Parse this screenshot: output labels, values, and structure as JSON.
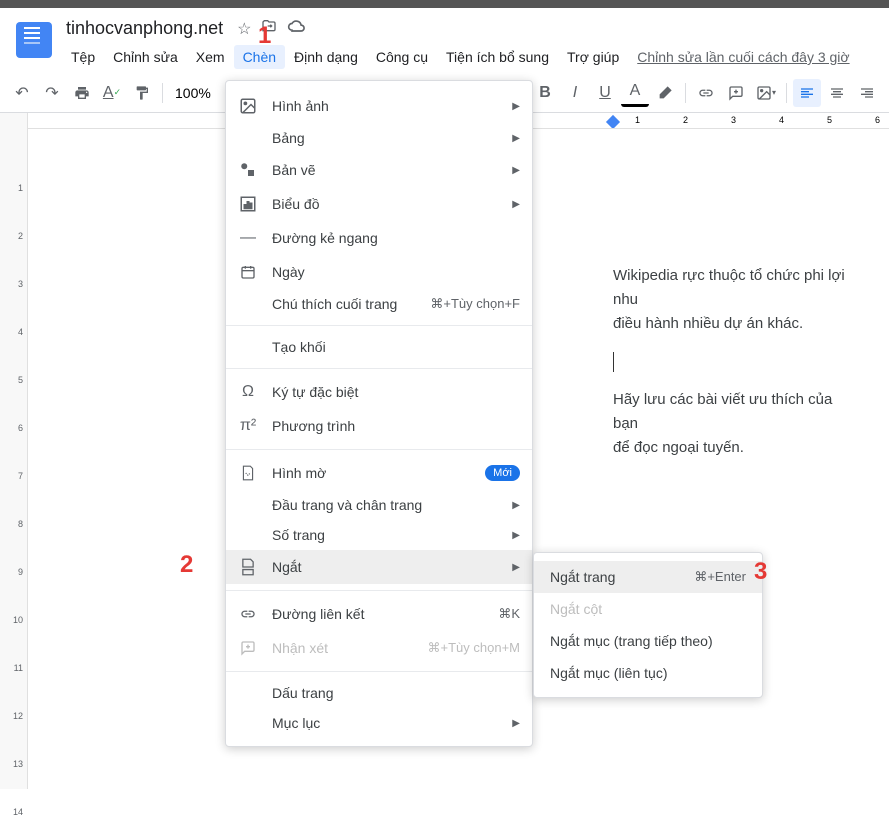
{
  "doc_title": "tinhocvanphong.net",
  "menubar": [
    "Tệp",
    "Chỉnh sửa",
    "Xem",
    "Chèn",
    "Định dạng",
    "Công cụ",
    "Tiện ích bổ sung",
    "Trợ giúp"
  ],
  "active_menu_index": 3,
  "last_edit": "Chỉnh sửa lần cuối cách đây 3 giờ",
  "zoom": "100%",
  "dropdown_items": [
    {
      "icon": "image",
      "label": "Hình ảnh",
      "arrow": true
    },
    {
      "indent": true,
      "label": "Bảng",
      "arrow": true
    },
    {
      "icon": "drawing",
      "label": "Bản vẽ",
      "arrow": true
    },
    {
      "icon": "chart",
      "label": "Biểu đồ",
      "arrow": true
    },
    {
      "icon": "hr",
      "label": "Đường kẻ ngang"
    },
    {
      "icon": "date",
      "label": "Ngày"
    },
    {
      "indent": true,
      "label": "Chú thích cuối trang",
      "shortcut": "⌘+Tùy chọn+F"
    },
    {
      "sep": true
    },
    {
      "indent": true,
      "label": "Tạo khối"
    },
    {
      "sep": true
    },
    {
      "icon": "omega",
      "label": "Ký tự đặc biệt"
    },
    {
      "icon": "pi",
      "label": "Phương trình"
    },
    {
      "sep": true
    },
    {
      "icon": "watermark",
      "label": "Hình mờ",
      "badge": "Mới"
    },
    {
      "indent": true,
      "label": "Đầu trang và chân trang",
      "arrow": true
    },
    {
      "indent": true,
      "label": "Số trang",
      "arrow": true
    },
    {
      "icon": "break",
      "label": "Ngắt",
      "arrow": true,
      "highlighted": true
    },
    {
      "sep": true
    },
    {
      "icon": "link",
      "label": "Đường liên kết",
      "shortcut": "⌘K"
    },
    {
      "icon": "comment",
      "label": "Nhận xét",
      "shortcut": "⌘+Tùy chọn+M",
      "disabled": true
    },
    {
      "sep": true
    },
    {
      "indent": true,
      "label": "Dấu trang"
    },
    {
      "indent": true,
      "label": "Mục lục",
      "arrow": true
    }
  ],
  "submenu_items": [
    {
      "label": "Ngắt trang",
      "shortcut": "⌘+Enter",
      "highlighted": true
    },
    {
      "label": "Ngắt cột",
      "disabled": true
    },
    {
      "label": "Ngắt mục (trang tiếp theo)"
    },
    {
      "label": "Ngắt mục (liên tục)"
    }
  ],
  "page_text1": "Wikipedia rực thuộc tổ chức phi lợi nhu",
  "page_text2": "điều hành nhiều dự án khác.",
  "page_text3": "Hãy lưu các bài viết ưu thích của bạn",
  "page_text4": "để đọc ngoại tuyến.",
  "annotations": {
    "a1": "1",
    "a2": "2",
    "a3": "3"
  },
  "ruler_h": [
    "1",
    "2",
    "3",
    "4",
    "5",
    "6"
  ]
}
